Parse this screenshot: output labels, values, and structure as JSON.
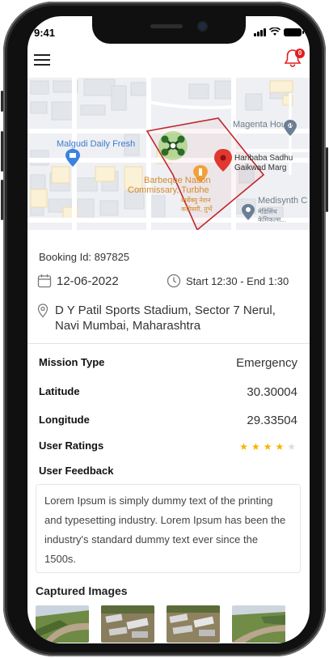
{
  "status_bar": {
    "time": "9:41"
  },
  "header": {
    "notification_count": "0"
  },
  "map": {
    "labels": {
      "magenta_house": "Magenta House",
      "malgudi": "Malgudi Daily Fresh",
      "haribaba": "Haribaba Sadhu",
      "gaikwad": "Gaikwad Marg",
      "barbeque": "Barbeque Nation",
      "commissary": "Commissary, Turbhe",
      "barbeque_hi": "बार्बेक्यु नेशन",
      "commissary_hi": "कमिसरी, तुर्भे",
      "medisynth": "Medisynth C",
      "medisynth_hi1": "मेडिसिंथ",
      "medisynth_hi2": "केमिकल्स..."
    }
  },
  "booking": {
    "id_text": "Booking Id: 897825",
    "date": "12-06-2022",
    "time_slot": "Start 12:30 - End 1:30",
    "address_line1": "D Y Patil Sports Stadium, Sector 7 Nerul,",
    "address_line2": "Navi Mumbai, Maharashtra"
  },
  "details": {
    "mission_type": {
      "label": "Mission Type",
      "value": "Emergency"
    },
    "latitude": {
      "label": "Latitude",
      "value": "30.30004"
    },
    "longitude": {
      "label": "Longitude",
      "value": "29.33504"
    },
    "user_ratings": {
      "label": "User Ratings",
      "value": 4,
      "max": 5
    },
    "user_feedback": {
      "label": "User Feedback"
    }
  },
  "feedback_text": "Lorem Ipsum is simply dummy text of the printing and typesetting industry. Lorem Ipsum has been the industry's standard dummy text ever since the 1500s.",
  "captured_images": {
    "title": "Captured Images"
  },
  "colors": {
    "accent_red": "#e01f1f",
    "star": "#f5b400",
    "polygon": "#c0262c"
  }
}
